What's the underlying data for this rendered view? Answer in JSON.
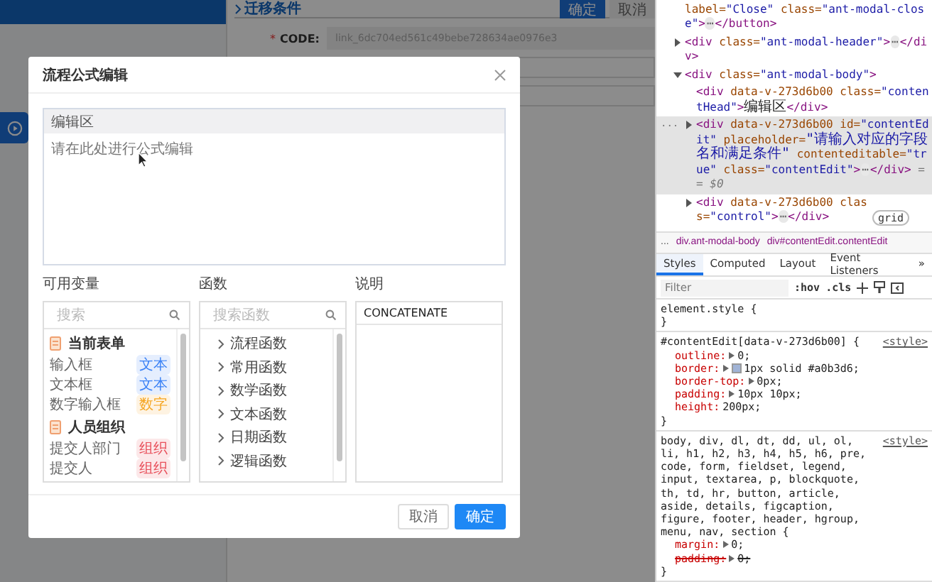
{
  "app": {
    "section_title": "迁移条件",
    "confirm_button": "确定",
    "cancel_button": "取消",
    "code_required": "*",
    "code_label": "CODE:",
    "code_value": "link_6dc704ed561c49bebe728634ae0976e3"
  },
  "modal": {
    "title": "流程公式编辑",
    "editor": {
      "heading": "编辑区",
      "placeholder": "请在此处进行公式编辑"
    },
    "variables": {
      "label": "可用变量",
      "search_placeholder": "搜索",
      "groups": [
        {
          "name": "当前表单",
          "items": [
            {
              "name": "输入框",
              "tag": "文本",
              "color": "#3b82f6"
            },
            {
              "name": "文本框",
              "tag": "文本",
              "color": "#3b82f6"
            },
            {
              "name": "数字输入框",
              "tag": "数字",
              "color": "#f5a623"
            }
          ]
        },
        {
          "name": "人员组织",
          "items": [
            {
              "name": "提交人部门",
              "tag": "组织",
              "color": "#e8505b"
            },
            {
              "name": "提交人",
              "tag": "组织",
              "color": "#e8505b"
            }
          ]
        }
      ]
    },
    "functions": {
      "label": "函数",
      "search_placeholder": "搜索函数",
      "items": [
        "流程函数",
        "常用函数",
        "数学函数",
        "文本函数",
        "日期函数",
        "逻辑函数"
      ]
    },
    "description": {
      "label": "说明",
      "heading": "CONCATENATE"
    },
    "buttons": [
      {
        "label": "取消",
        "kind": "default"
      },
      {
        "label": "确定",
        "kind": "primary"
      }
    ]
  },
  "devtools": {
    "dom_tree": [
      {
        "selected": false,
        "parts": [
          {
            "kind": "attr",
            "text": "label="
          },
          {
            "kind": "val",
            "text": "\"Close\""
          },
          {
            "kind": "attr",
            "text": " class="
          },
          {
            "kind": "val",
            "text": "\"ant-modal-close\""
          },
          {
            "kind": "tag",
            "text": ">"
          },
          {
            "kind": "pill",
            "text": "⋯"
          },
          {
            "kind": "tag",
            "text": "</button>"
          }
        ]
      },
      {
        "expanded": false,
        "selected": false,
        "parts": [
          {
            "kind": "tag",
            "text": "<div"
          },
          {
            "kind": "attr",
            "text": " class="
          },
          {
            "kind": "val",
            "text": "\"ant-modal-header\""
          },
          {
            "kind": "tag",
            "text": ">"
          },
          {
            "kind": "pill",
            "text": "⋯"
          },
          {
            "kind": "tag",
            "text": "</div>"
          }
        ]
      },
      {
        "expanded": true,
        "selected": false,
        "parts": [
          {
            "kind": "tag",
            "text": "<div"
          },
          {
            "kind": "attr",
            "text": " class="
          },
          {
            "kind": "val",
            "text": "\"ant-modal-body\""
          },
          {
            "kind": "tag",
            "text": ">"
          }
        ],
        "children": [
          {
            "selected": false,
            "parts": [
              {
                "kind": "tag",
                "text": "<div"
              },
              {
                "kind": "attr",
                "text": " data-v-273d6b00"
              },
              {
                "kind": "attr",
                "text": " class="
              },
              {
                "kind": "val",
                "text": "\"contentHead\""
              },
              {
                "kind": "tag",
                "text": ">"
              },
              {
                "kind": "text",
                "text": "编辑区"
              },
              {
                "kind": "tag",
                "text": "</div>"
              }
            ]
          },
          {
            "expanded": false,
            "selected": true,
            "gutter": "...",
            "parts": [
              {
                "kind": "tag",
                "text": "<div"
              },
              {
                "kind": "attr",
                "text": " data-v-273d6b00"
              },
              {
                "kind": "attr",
                "text": " id="
              },
              {
                "kind": "val",
                "text": "\"contentEdit\""
              },
              {
                "kind": "attr",
                "text": " placeholder="
              },
              {
                "kind": "val",
                "text": "\"请输入对应的字段名和满足条件\""
              },
              {
                "kind": "attr",
                "text": " contenteditable="
              },
              {
                "kind": "val",
                "text": "\"true\""
              },
              {
                "kind": "attr",
                "text": " class="
              },
              {
                "kind": "val",
                "text": "\"contentEdit\""
              },
              {
                "kind": "tag",
                "text": ">"
              },
              {
                "kind": "pill",
                "text": "⋯"
              },
              {
                "kind": "tag",
                "text": "</div>"
              },
              {
                "kind": "note",
                "text": " == $0"
              }
            ]
          },
          {
            "expanded": false,
            "selected": false,
            "badge": "grid",
            "parts": [
              {
                "kind": "tag",
                "text": "<div"
              },
              {
                "kind": "attr",
                "text": " data-v-273d6b00"
              },
              {
                "kind": "attr",
                "text": " class="
              },
              {
                "kind": "val",
                "text": "\"control\""
              },
              {
                "kind": "tag",
                "text": ">"
              },
              {
                "kind": "pill",
                "text": "⋯"
              },
              {
                "kind": "tag",
                "text": "</div>"
              }
            ]
          }
        ]
      }
    ],
    "breadcrumbs": [
      "...",
      "div.ant-modal-body",
      "div#contentEdit.contentEdit"
    ],
    "tabs": [
      {
        "label": "Styles",
        "selected": true
      },
      {
        "label": "Computed",
        "selected": false
      },
      {
        "label": "Layout",
        "selected": false
      },
      {
        "label": "Event Listeners",
        "selected": false
      }
    ],
    "more_tabs": "»",
    "filter": {
      "placeholder": "Filter",
      "hov": ":hov",
      "cls": ".cls"
    },
    "rules": [
      {
        "selector": "element.style {",
        "closing": "}"
      },
      {
        "selector": "#contentEdit[data-v-273d6b00] {",
        "source": "<style>",
        "closing": "}",
        "declarations": [
          {
            "prop": "outline:",
            "value": "0;",
            "expandable": true,
            "struck": false
          },
          {
            "prop": "border:",
            "value": "1px solid #a0b3d6;",
            "expandable": true,
            "struck": false,
            "color": "#a0b3d6"
          },
          {
            "prop": "border-top:",
            "value": "0px;",
            "expandable": true,
            "struck": false
          },
          {
            "prop": "padding:",
            "value": "10px 10px;",
            "expandable": true,
            "struck": false
          },
          {
            "prop": "height:",
            "value": "200px;",
            "expandable": false,
            "struck": false
          }
        ]
      },
      {
        "selector": "body, div, dl, dt, dd, ul, ol, li, h1, h2, h3, h4, h5, h6, pre, code, form, fieldset, legend, input, textarea, p, blockquote, th, td, hr, button, article, aside, details, figcaption, figure, footer, header, hgroup, menu, nav, section {",
        "source": "<style>",
        "closing": "}",
        "declarations": [
          {
            "prop": "margin:",
            "value": "0;",
            "expandable": true,
            "struck": false
          },
          {
            "prop": "padding:",
            "value": "0;",
            "expandable": true,
            "struck": true
          }
        ]
      }
    ]
  }
}
